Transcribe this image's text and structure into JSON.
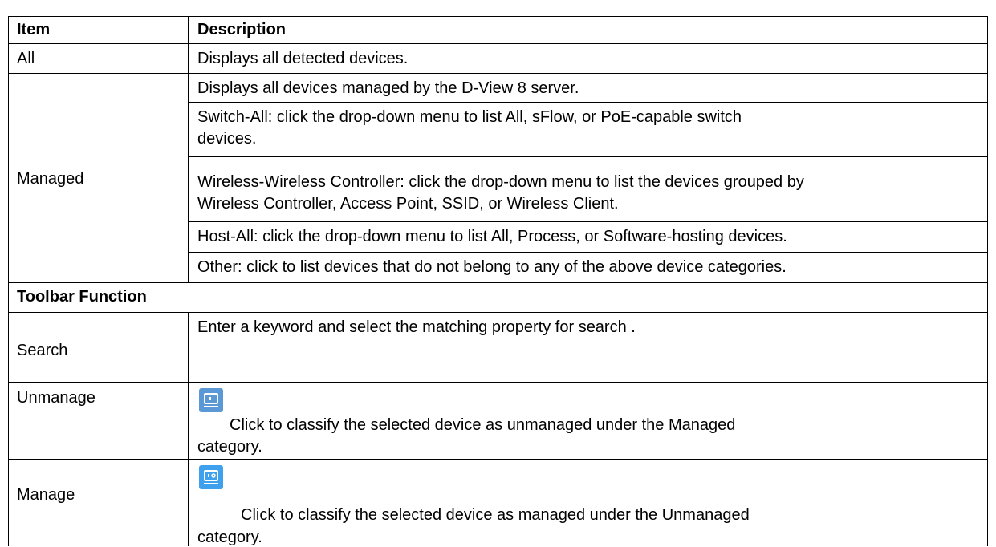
{
  "table": {
    "header": {
      "item": "Item",
      "description": "Description"
    },
    "rows": [
      {
        "item": "All",
        "description": "Displays all detected devices."
      },
      {
        "item": "Managed",
        "sub": [
          {
            "lines": [
              "Displays all devices managed by the D-View 8 server."
            ]
          },
          {
            "lines": [
              "Switch-All: click the drop-down menu to list All, sFlow, or PoE-capable switch",
              "devices."
            ]
          },
          {
            "lines": [
              "Wireless-Wireless Controller: click the drop-down menu to list the devices grouped by",
              "Wireless Controller, Access Point, SSID, or Wireless Client."
            ]
          },
          {
            "lines": [
              "Host-All:  click the drop-down menu to list All, Process, or Software-hosting devices."
            ]
          },
          {
            "lines": [
              "Other: click to list devices that do not belong to any of the above device categories."
            ]
          }
        ]
      }
    ],
    "section_title": "Toolbar Function",
    "toolbar": [
      {
        "item": "Search",
        "lines": [
          "Enter a keyword and select the matching property for search ."
        ]
      },
      {
        "item": "Unmanage",
        "icon": "unmanage-icon",
        "lines": [
          "Click to classify the selected device as unmanaged under the Managed",
          "category."
        ]
      },
      {
        "item": "Manage",
        "icon": "manage-icon",
        "lines": [
          "Click to classify the selected device as managed under the Unmanaged",
          "category."
        ]
      }
    ]
  }
}
